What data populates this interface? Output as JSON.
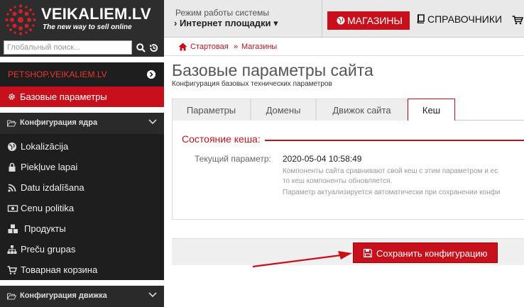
{
  "brand": {
    "name": "VEIKALIEM.LV",
    "tagline": "The new way to sell online",
    "accent": "#c8101c"
  },
  "search": {
    "placeholder": "Глобальный поиск..."
  },
  "topbar": {
    "mode_label": "Режим работы системы",
    "mode_value": "› Интернет площадки ▾",
    "shops_button": "МАГАЗИНЫ",
    "reference_button": "СПРАВОЧНИКИ"
  },
  "breadcrumb": {
    "home": "Стартовая",
    "separator": "»",
    "current": "Магазины"
  },
  "sidebar": {
    "shop_name": "PETSHOP.VEIKALIEM.LV",
    "active_item": "Базовые параметры",
    "group_core": "Конфигурация ядра",
    "items": [
      {
        "label": "Lokalizācija",
        "icon": "globe-icon"
      },
      {
        "label": "Piekļuve lapai",
        "icon": "lock-icon"
      },
      {
        "label": "Datu izdalīšana",
        "icon": "rss-icon"
      },
      {
        "label": "Cenu politika",
        "icon": "money-icon"
      },
      {
        "label": "Продукты",
        "icon": "cubes-icon"
      },
      {
        "label": "Preču grupas",
        "icon": "sitemap-icon"
      },
      {
        "label": "Товарная корзина",
        "icon": "cart-icon"
      }
    ],
    "group_engine": "Конфигурация движка"
  },
  "page": {
    "title": "Базовые параметры сайта",
    "subtitle": "Конфигурация базовых технических параметров"
  },
  "tabs": [
    {
      "label": "Параметры",
      "active": false
    },
    {
      "label": "Домены",
      "active": false
    },
    {
      "label": "Движок сайта",
      "active": false
    },
    {
      "label": "Кеш",
      "active": true
    }
  ],
  "cache": {
    "legend": "Состояние кеша:",
    "param_label": "Текущий параметр:",
    "param_value": "2020-05-04 10:58:49",
    "help_line1": "Компоненты сайта сравнивают свой кеш с этим параметром и ес",
    "help_line2": "то кеш компоненты обновляется.",
    "help_line3": "Параметр актуализируется автоматически при сохранении конфи"
  },
  "actions": {
    "save_label": "Сохранить конфигурацию"
  }
}
